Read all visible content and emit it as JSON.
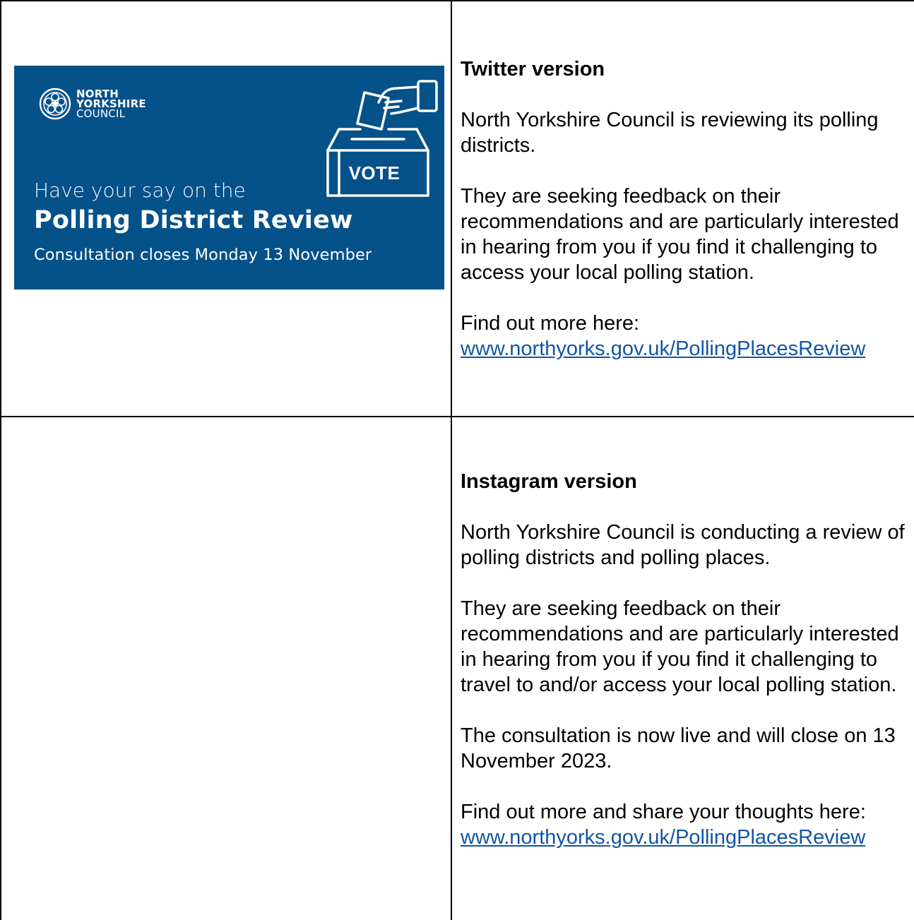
{
  "banner": {
    "logo_line1": "NORTH",
    "logo_line2": "YORKSHIRE",
    "logo_line3": "COUNCIL",
    "vote_label": "VOTE",
    "tagline": "Have your say on the",
    "headline": "Polling District Review",
    "closes": "Consultation closes Monday 13 November",
    "colors": {
      "background": "#05518a",
      "text": "#ffffff"
    },
    "icons": [
      "council-rose-logo-icon",
      "ballot-box-icon",
      "hand-ballot-icon",
      "phone-icon"
    ]
  },
  "twitter": {
    "heading": "Twitter version",
    "para1": "North Yorkshire Council is reviewing its polling districts.",
    "para2": "They are seeking feedback on their recommendations and are particularly interested in hearing from you if you find it challenging to access your local polling station.",
    "find_out": "Find out more here:",
    "link": "www.northyorks.gov.uk/PollingPlacesReview"
  },
  "instagram": {
    "heading": "Instagram version",
    "para1": "North Yorkshire Council is conducting a review of polling districts and polling places.",
    "para2": "They are seeking feedback on their recommendations and are particularly interested in hearing from you if you find it challenging to travel to and/or access your local polling station.",
    "para3": "The consultation is now live and will close on 13 November 2023.",
    "find_out": "Find out more and share your thoughts here:",
    "link": "www.northyorks.gov.uk/PollingPlacesReview"
  },
  "colors": {
    "link": "#1255a4",
    "border": "#000000"
  }
}
